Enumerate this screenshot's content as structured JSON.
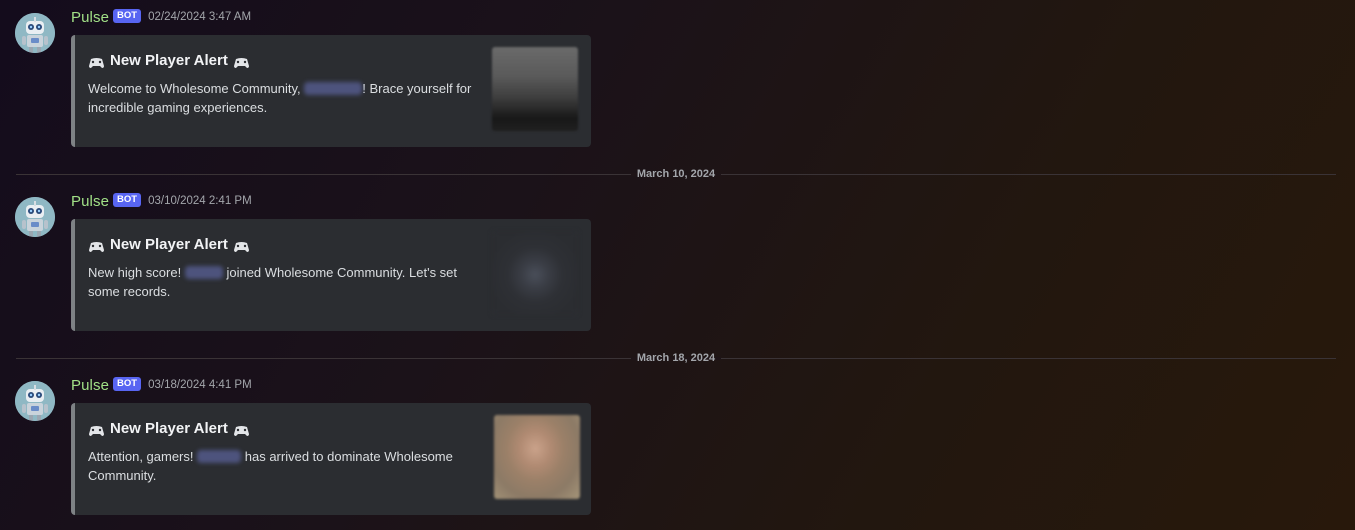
{
  "colors": {
    "username": "#a1e087",
    "bot_badge": "#5865f2",
    "embed_bg": "#2b2d31",
    "embed_border": "#7e8285",
    "timestamp": "#a3a6ab"
  },
  "messages": [
    {
      "username": "Pulse",
      "badge": "BOT",
      "timestamp": "02/24/2024 3:47 AM",
      "avatar_icon": "robot-avatar-icon",
      "embed": {
        "title_icon": "gamepad-icon",
        "title": "New Player Alert",
        "desc_before": "Welcome to Wholesome Community,",
        "desc_after": "! Brace yourself for incredible gaming experiences."
      }
    },
    {
      "username": "Pulse",
      "badge": "BOT",
      "timestamp": "03/10/2024 2:41 PM",
      "avatar_icon": "robot-avatar-icon",
      "embed": {
        "title_icon": "gamepad-icon",
        "title": "New Player Alert",
        "desc_before": "New high score!",
        "desc_after": "joined Wholesome Community. Let's set some records."
      }
    },
    {
      "username": "Pulse",
      "badge": "BOT",
      "timestamp": "03/18/2024 4:41 PM",
      "avatar_icon": "robot-avatar-icon",
      "embed": {
        "title_icon": "gamepad-icon",
        "title": "New Player Alert",
        "desc_before": "Attention, gamers!",
        "desc_after": "has arrived to dominate Wholesome Community."
      }
    }
  ],
  "dividers": [
    {
      "label": "March 10, 2024"
    },
    {
      "label": "March 18, 2024"
    }
  ]
}
